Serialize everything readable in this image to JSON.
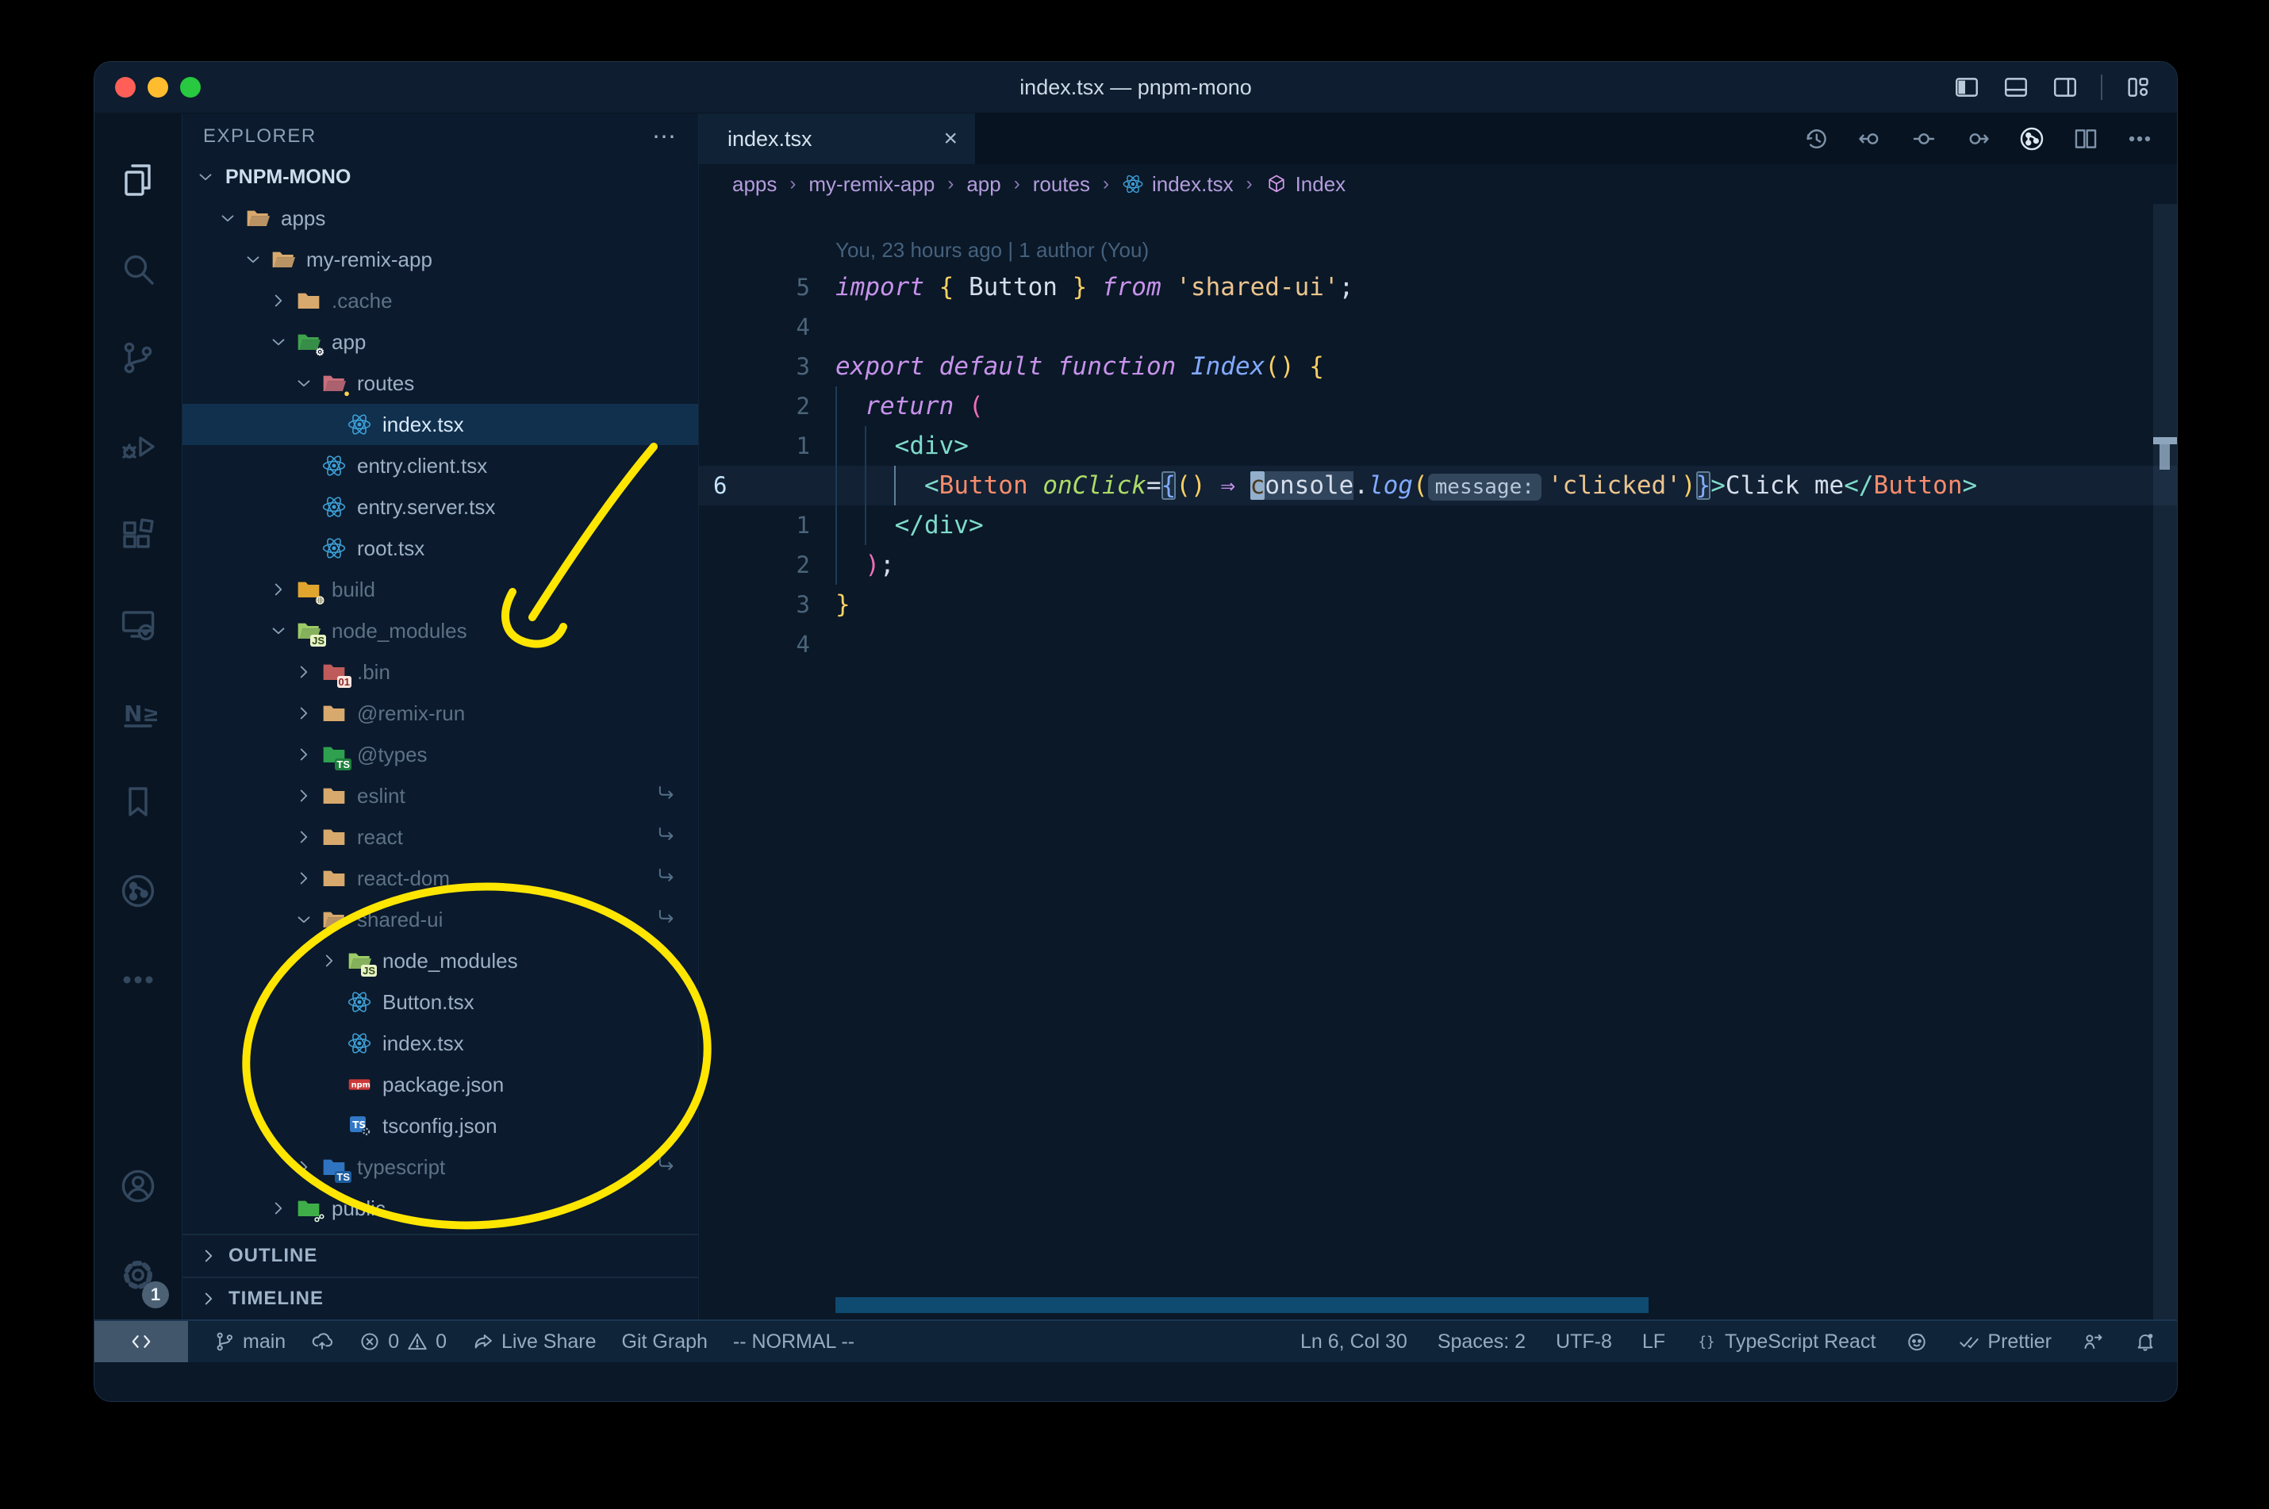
{
  "window": {
    "title": "index.tsx — pnpm-mono"
  },
  "titlebar": {
    "layout_controls": [
      "toggle-sidebar-left",
      "toggle-panel",
      "toggle-sidebar-right",
      "customize-layout"
    ]
  },
  "activity_bar": {
    "top": [
      {
        "name": "explorer",
        "active": true
      },
      {
        "name": "search"
      },
      {
        "name": "source-control"
      },
      {
        "name": "run-debug"
      },
      {
        "name": "extensions"
      },
      {
        "name": "remote-explorer"
      },
      {
        "name": "nx-console"
      },
      {
        "name": "bookmarks"
      },
      {
        "name": "git-graph"
      },
      {
        "name": "more"
      }
    ],
    "bottom": [
      {
        "name": "accounts"
      },
      {
        "name": "settings",
        "badge": "1"
      }
    ]
  },
  "explorer": {
    "header": "EXPLORER",
    "section": "PNPM-MONO",
    "outline": "OUTLINE",
    "timeline": "TIMELINE",
    "tree": [
      {
        "label": "apps",
        "level": 1,
        "icon": "folder-open",
        "chevron": "down"
      },
      {
        "label": "my-remix-app",
        "level": 2,
        "icon": "folder-open",
        "chevron": "down"
      },
      {
        "label": ".cache",
        "level": 3,
        "icon": "folder",
        "chevron": "right",
        "dim": true
      },
      {
        "label": "app",
        "level": 3,
        "icon": "folder-app",
        "chevron": "down"
      },
      {
        "label": "routes",
        "level": 4,
        "icon": "folder-routes",
        "chevron": "down"
      },
      {
        "label": "index.tsx",
        "level": 5,
        "icon": "react",
        "selected": true
      },
      {
        "label": "entry.client.tsx",
        "level": 4,
        "icon": "react"
      },
      {
        "label": "entry.server.tsx",
        "level": 4,
        "icon": "react"
      },
      {
        "label": "root.tsx",
        "level": 4,
        "icon": "react"
      },
      {
        "label": "build",
        "level": 3,
        "icon": "folder-build",
        "chevron": "right",
        "dim": true
      },
      {
        "label": "node_modules",
        "level": 3,
        "icon": "folder-node",
        "chevron": "down",
        "dim": true
      },
      {
        "label": ".bin",
        "level": 4,
        "icon": "folder-bin",
        "chevron": "right",
        "dim": true
      },
      {
        "label": "@remix-run",
        "level": 4,
        "icon": "folder",
        "chevron": "right",
        "dim": true
      },
      {
        "label": "@types",
        "level": 4,
        "icon": "folder-types",
        "chevron": "right",
        "dim": true
      },
      {
        "label": "eslint",
        "level": 4,
        "icon": "folder",
        "chevron": "right",
        "dim": true,
        "symlink": true
      },
      {
        "label": "react",
        "level": 4,
        "icon": "folder",
        "chevron": "right",
        "dim": true,
        "symlink": true
      },
      {
        "label": "react-dom",
        "level": 4,
        "icon": "folder",
        "chevron": "right",
        "dim": true,
        "symlink": true
      },
      {
        "label": "shared-ui",
        "level": 4,
        "icon": "folder-open",
        "chevron": "down",
        "dim": true,
        "symlink": true
      },
      {
        "label": "node_modules",
        "level": 5,
        "icon": "folder-node",
        "chevron": "right"
      },
      {
        "label": "Button.tsx",
        "level": 5,
        "icon": "react"
      },
      {
        "label": "index.tsx",
        "level": 5,
        "icon": "react"
      },
      {
        "label": "package.json",
        "level": 5,
        "icon": "npm"
      },
      {
        "label": "tsconfig.json",
        "level": 5,
        "icon": "ts-config"
      },
      {
        "label": "typescript",
        "level": 4,
        "icon": "folder-ts",
        "chevron": "right",
        "dim": true,
        "symlink": true
      },
      {
        "label": "public",
        "level": 3,
        "icon": "folder-public",
        "chevron": "right"
      }
    ]
  },
  "editor": {
    "tab": {
      "label": "index.tsx",
      "icon": "react",
      "close": "×"
    },
    "actions": [
      "history",
      "prev-change",
      "center-change",
      "next-change",
      "git-graph-action",
      "split-editor",
      "more-actions"
    ],
    "breadcrumbs": [
      {
        "label": "apps"
      },
      {
        "label": "my-remix-app"
      },
      {
        "label": "app"
      },
      {
        "label": "routes"
      },
      {
        "label": "index.tsx",
        "icon": "react"
      },
      {
        "label": "Index",
        "icon": "symbol-module"
      }
    ],
    "blame": "You, 23 hours ago | 1 author (You)",
    "lines": [
      {
        "n": "5",
        "t": [
          [
            "import ",
            "kw"
          ],
          [
            "{ ",
            "y"
          ],
          [
            "Button",
            "w"
          ],
          [
            " }",
            "y"
          ],
          [
            " from ",
            "kw"
          ],
          [
            "'shared-ui'",
            "str"
          ],
          [
            ";",
            "w"
          ]
        ]
      },
      {
        "n": "4",
        "t": []
      },
      {
        "n": "3",
        "t": [
          [
            "export ",
            "kw"
          ],
          [
            "default ",
            "kw"
          ],
          [
            "function ",
            "kw"
          ],
          [
            "Index",
            "fn"
          ],
          [
            "()",
            "y"
          ],
          [
            " ",
            "w"
          ],
          [
            "{",
            "y"
          ]
        ]
      },
      {
        "n": "2",
        "t": [
          [
            "  ",
            "w"
          ],
          [
            "return ",
            "kw"
          ],
          [
            "(",
            "pk"
          ]
        ]
      },
      {
        "n": "1",
        "t": [
          [
            "    ",
            "w"
          ],
          [
            "<div>",
            "tl"
          ]
        ]
      },
      {
        "n": "6",
        "current": true,
        "t": [
          [
            "      ",
            "w"
          ],
          [
            "<",
            "tl"
          ],
          [
            "Button",
            "cmp"
          ],
          [
            " ",
            "w"
          ],
          [
            "onClick",
            "attr"
          ],
          [
            "=",
            "w"
          ],
          [
            "{",
            "bbox"
          ],
          [
            "()",
            "y"
          ],
          [
            " ",
            "w"
          ],
          [
            "⇒",
            "arrow"
          ],
          [
            " ",
            "w"
          ],
          [
            "c",
            "cursor"
          ],
          [
            "onsole",
            "whl"
          ],
          [
            ".",
            "w"
          ],
          [
            "log",
            "fn"
          ],
          [
            "(",
            "y"
          ],
          [
            "message:",
            "inlay"
          ],
          [
            "'clicked'",
            "str"
          ],
          [
            ")",
            "y"
          ],
          [
            "}",
            "bbox"
          ],
          [
            ">",
            "tl"
          ],
          [
            "Click me",
            "w"
          ],
          [
            "</",
            "tl"
          ],
          [
            "Button",
            "cmp"
          ],
          [
            ">",
            "tl"
          ]
        ]
      },
      {
        "n": "1",
        "t": [
          [
            "    ",
            "w"
          ],
          [
            "</div>",
            "tl"
          ]
        ]
      },
      {
        "n": "2",
        "t": [
          [
            "  ",
            "w"
          ],
          [
            ")",
            "pk"
          ],
          [
            ";",
            "w"
          ]
        ]
      },
      {
        "n": "3",
        "t": [
          [
            "}",
            "y"
          ]
        ]
      },
      {
        "n": "4",
        "t": []
      }
    ]
  },
  "statusbar": {
    "left": [
      {
        "name": "remote",
        "icon": "remote",
        "cell": true
      },
      {
        "name": "branch",
        "parts": [
          {
            "icon": "branch"
          },
          {
            "text": "main"
          }
        ]
      },
      {
        "name": "publish",
        "parts": [
          {
            "icon": "cloud-upload"
          }
        ]
      },
      {
        "name": "problems",
        "parts": [
          {
            "icon": "error"
          },
          {
            "text": "0"
          },
          {
            "icon": "warning"
          },
          {
            "text": "0"
          }
        ]
      },
      {
        "name": "live-share",
        "parts": [
          {
            "icon": "live-share"
          },
          {
            "text": "Live Share"
          }
        ]
      },
      {
        "name": "git-graph",
        "parts": [
          {
            "text": "Git Graph"
          }
        ]
      },
      {
        "name": "vim-mode",
        "parts": [
          {
            "text": "-- NORMAL --"
          }
        ]
      }
    ],
    "right": [
      {
        "name": "cursor-position",
        "parts": [
          {
            "text": "Ln 6, Col 30"
          }
        ]
      },
      {
        "name": "indentation",
        "parts": [
          {
            "text": "Spaces: 2"
          }
        ]
      },
      {
        "name": "encoding",
        "parts": [
          {
            "text": "UTF-8"
          }
        ]
      },
      {
        "name": "eol",
        "parts": [
          {
            "text": "LF"
          }
        ]
      },
      {
        "name": "language",
        "parts": [
          {
            "icon": "brackets"
          },
          {
            "text": "TypeScript React"
          }
        ]
      },
      {
        "name": "copilot",
        "parts": [
          {
            "icon": "octoface"
          }
        ]
      },
      {
        "name": "prettier",
        "parts": [
          {
            "icon": "double-check"
          },
          {
            "text": "Prettier"
          }
        ]
      },
      {
        "name": "feedback",
        "parts": [
          {
            "icon": "feedback"
          }
        ]
      },
      {
        "name": "notifications",
        "parts": [
          {
            "icon": "bell-dot"
          }
        ]
      }
    ]
  },
  "annotation_color": "#ffe600",
  "colors": {
    "editor_bg": "#0a1828",
    "sidebar_bg": "#0b1a2c",
    "status_bg": "#0f2438",
    "accent_yellow": "#fbd064",
    "accent_pink": "#ef6eb7",
    "accent_teal": "#7fdbca",
    "accent_purple": "#c792ea",
    "accent_salmon": "#f78c6c",
    "accent_blue": "#82aaff",
    "string": "#ecc48d"
  }
}
